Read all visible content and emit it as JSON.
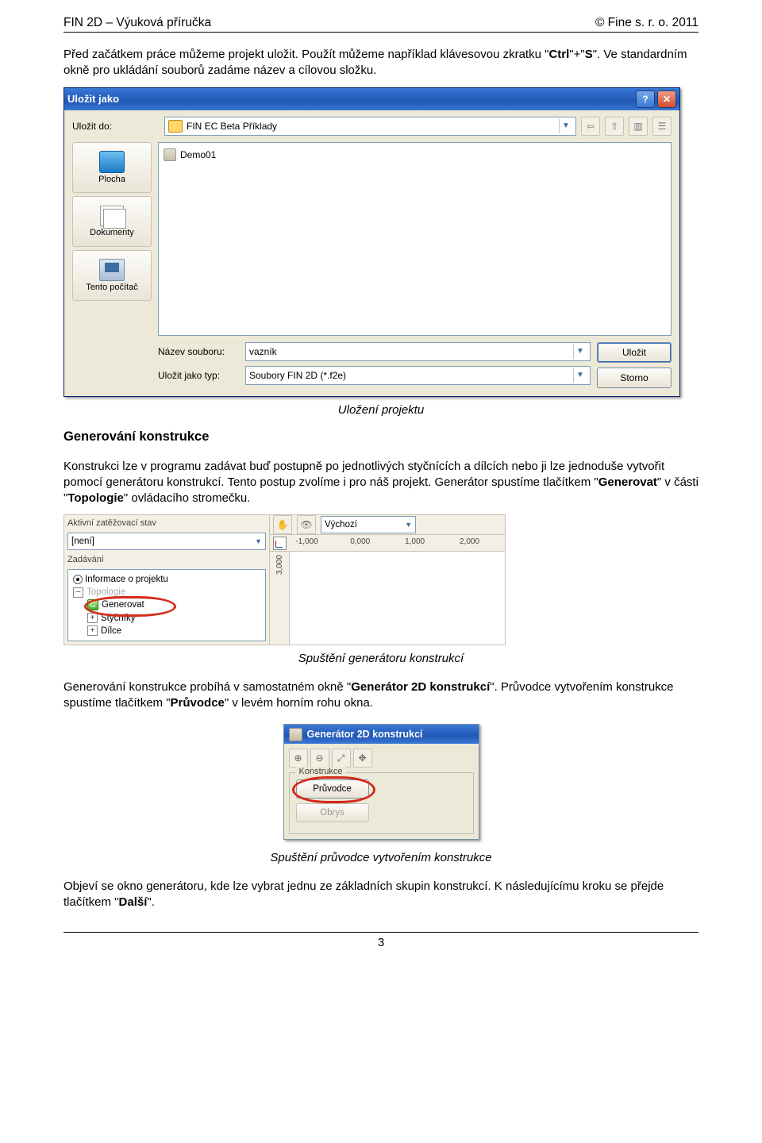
{
  "header": {
    "left": "FIN 2D – Výuková příručka",
    "right": "© Fine s. r. o. 2011"
  },
  "intro": {
    "text_a": "Před začátkem práce můžeme projekt uložit. Použít můžeme například klávesovou zkratku \"",
    "bold1": "Ctrl",
    "text_b": "\"+\"",
    "bold2": "S",
    "text_c": "\". Ve standardním okně pro ukládání souborů zadáme název a cílovou složku."
  },
  "save_dialog": {
    "title": "Uložit jako",
    "help_btn": "?",
    "close_btn": "✕",
    "save_to_label": "Uložit do:",
    "folder": "FIN EC Beta Příklady",
    "nav_back": "⇦",
    "nav_up": "⇧",
    "view_btn": "▥",
    "list_btn": "☰",
    "places": {
      "desktop": "Plocha",
      "documents": "Dokumenty",
      "computer": "Tento počítač"
    },
    "file_item": "Demo01",
    "filename_label": "Název souboru:",
    "filename_value": "vazník",
    "filetype_label": "Uložit jako typ:",
    "filetype_value": "Soubory FIN 2D (*.f2e)",
    "save_btn": "Uložit",
    "cancel_btn": "Storno"
  },
  "caption1": "Uložení projektu",
  "section1": {
    "heading": "Generování konstrukce",
    "para_a": "Konstrukci lze v programu zadávat buď postupně po jednotlivých styčnících a dílcích nebo ji lze jednoduše vytvořit pomocí generátoru konstrukcí. Tento postup zvolíme i pro náš projekt. Generátor spustíme tlačítkem \"",
    "bold1": "Generovat",
    "para_b": "\" v části \"",
    "bold2": "Topologie",
    "para_c": "\" ovládacího stromečku."
  },
  "topo": {
    "state_label": "Aktivní zatěžovací stav",
    "state_value": "[není]",
    "input_label": "Zadávání",
    "info_node": "Informace o projektu",
    "topo_node": "Topologie",
    "generate_node": "Generovat",
    "joints_node": "Styčníky",
    "members_node": "Dílce",
    "view_combo": "Výchozí",
    "svg_icon_letter": "G",
    "ticks": {
      "t0": "-1,000",
      "t1": "0,000",
      "t2": "1,000",
      "t3": "2,000"
    },
    "vtick": "3,000"
  },
  "caption2": "Spuštění generátoru konstrukcí",
  "section2": {
    "para_a": "Generování konstrukce probíhá v samostatném okně \"",
    "bold1": "Generátor 2D konstrukcí",
    "para_b": "\". Průvodce vytvořením konstrukce spustíme tlačítkem \"",
    "bold2": "Průvodce",
    "para_c": "\" v levém horním rohu okna."
  },
  "gen_dialog": {
    "title": "Generátor 2D konstrukcí",
    "zoom_in": "⊕",
    "zoom_out": "⊖",
    "fit": "⤢",
    "pan": "✥",
    "group_label": "Konstrukce",
    "wizard_btn": "Průvodce",
    "outline_btn": "Obrys"
  },
  "caption3": "Spuštění průvodce vytvořením konstrukce",
  "section3": {
    "para_a": "Objeví se okno generátoru, kde lze vybrat jednu ze základních skupin konstrukcí. K následujícímu kroku se přejde tlačítkem \"",
    "bold1": "Další",
    "para_b": "\"."
  },
  "page_number": "3"
}
